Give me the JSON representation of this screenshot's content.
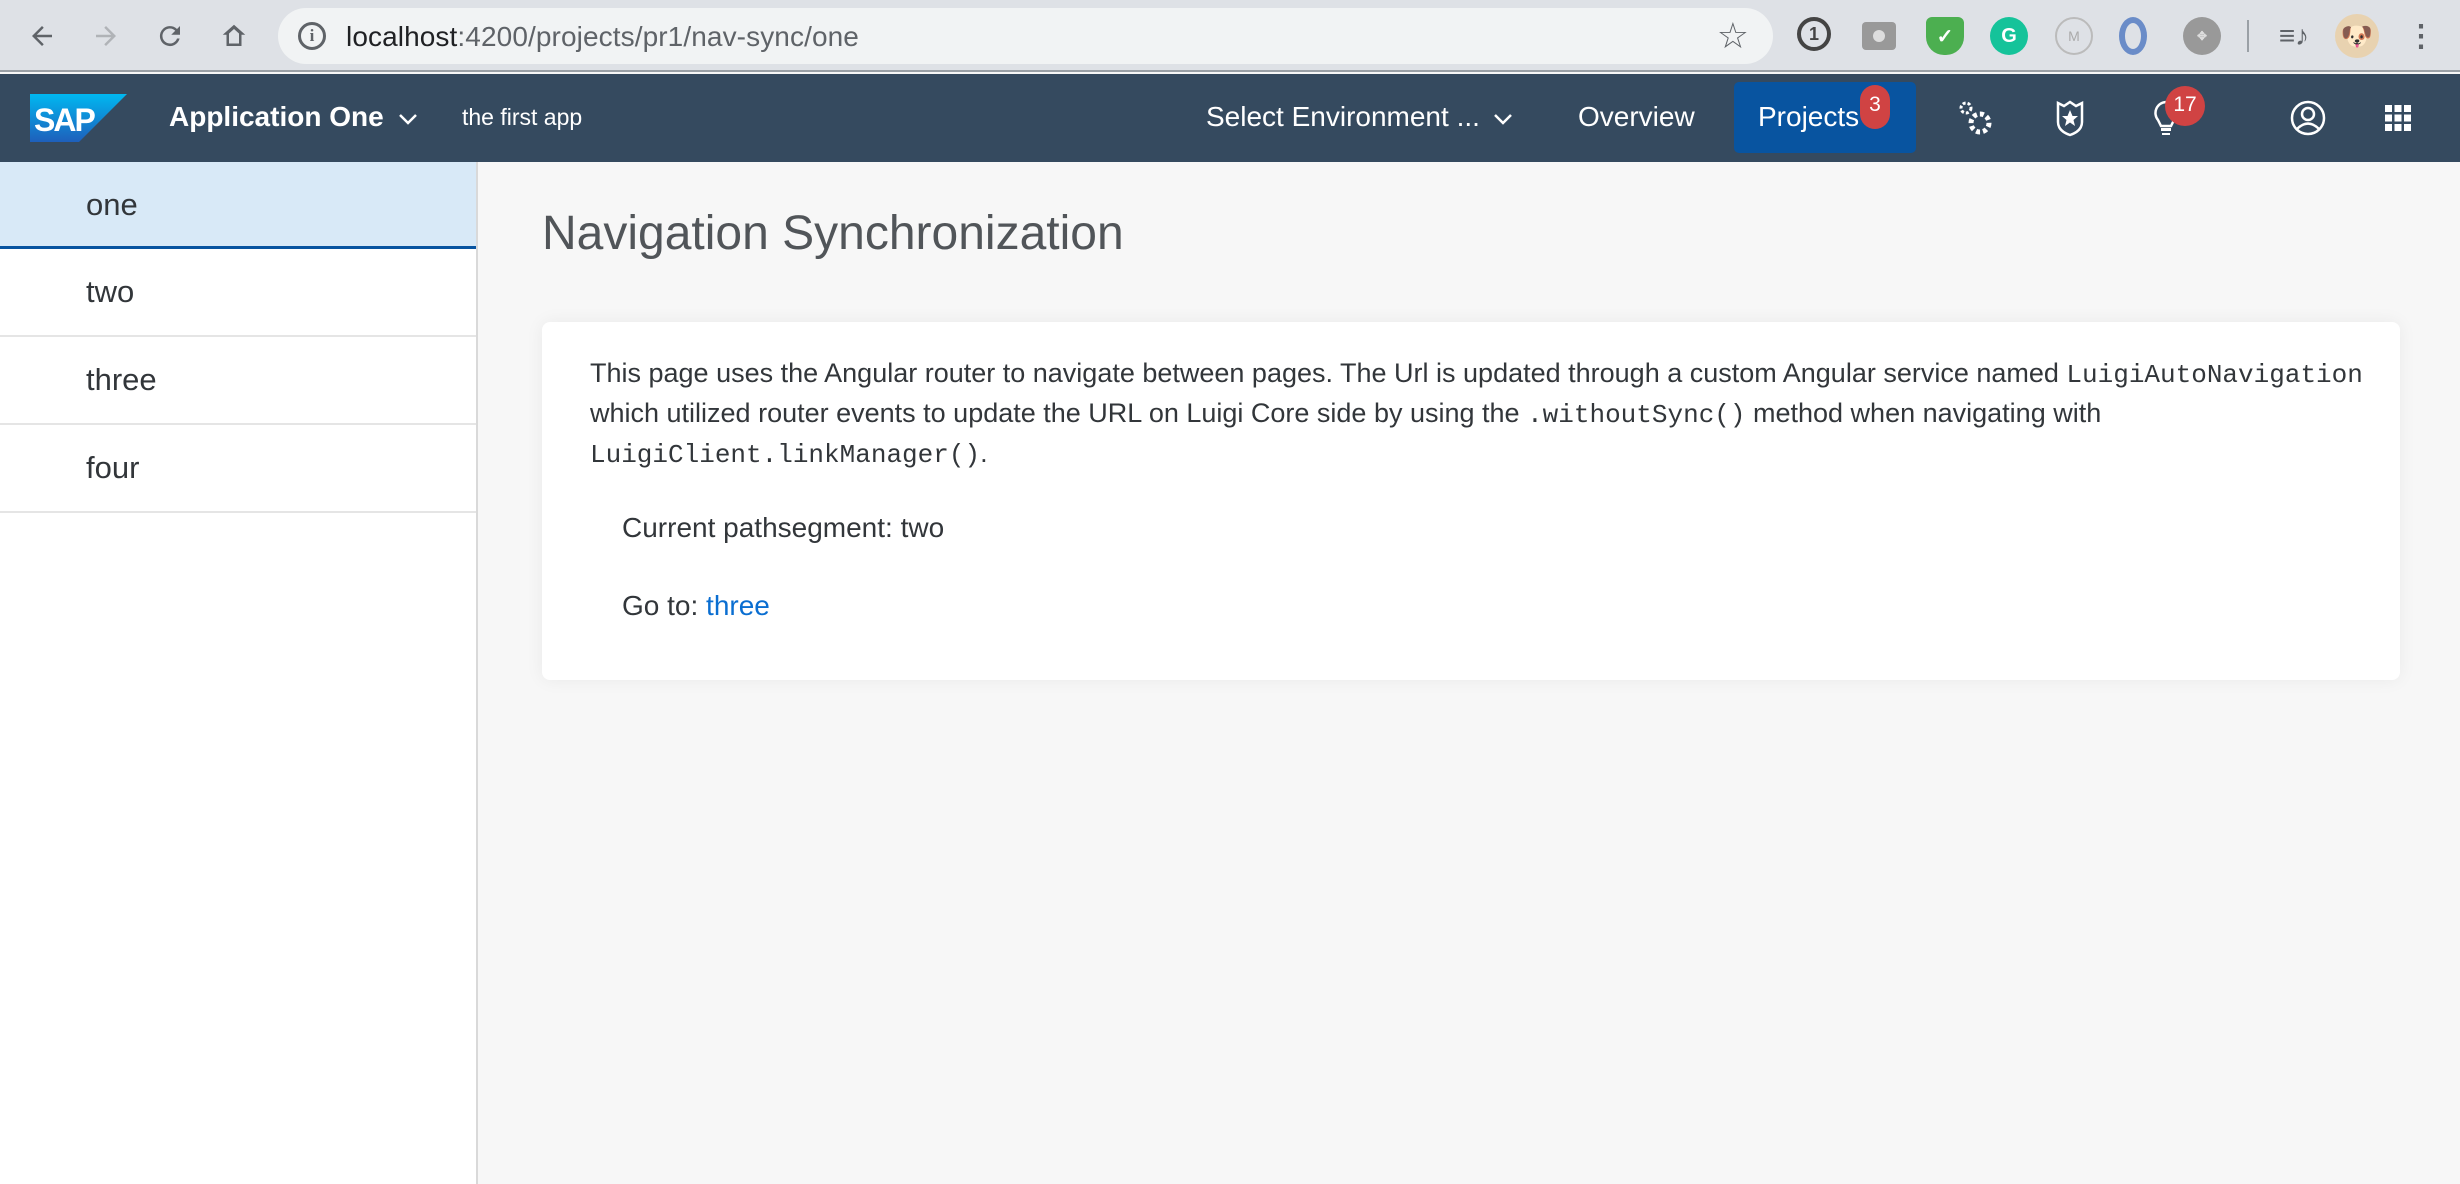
{
  "browser": {
    "url_host": "localhost",
    "url_path": ":4200/projects/pr1/nav-sync/one",
    "nav_icons": [
      "back-arrow-icon",
      "forward-arrow-icon",
      "reload-icon",
      "home-icon"
    ],
    "extensions": [
      "1password-icon",
      "camera-icon",
      "adguard-shield-icon",
      "grammarly-icon",
      "m-extension-icon",
      "ring-extension-icon",
      "dpad-extension-icon"
    ]
  },
  "shellbar": {
    "logo": "SAP",
    "app_title": "Application One",
    "app_subtitle": "the first app",
    "environment_select": "Select Environment ...",
    "nav": {
      "overview": "Overview",
      "projects": "Projects",
      "projects_badge": "3"
    },
    "notifications_badge": "17",
    "colors": {
      "shell_bg": "#354a5f",
      "active_nav_bg": "#0854a0",
      "badge_bg": "#d04343"
    }
  },
  "leftnav": {
    "items": [
      {
        "label": "one",
        "selected": true
      },
      {
        "label": "two",
        "selected": false
      },
      {
        "label": "three",
        "selected": false
      },
      {
        "label": "four",
        "selected": false
      }
    ]
  },
  "main": {
    "title": "Navigation Synchronization",
    "description": {
      "part1": "This page uses the Angular router to navigate between pages. The Url is updated through a custom Angular service named ",
      "code1": "LuigiAutoNavigation",
      "part2": " which utilized router events to update the URL on Luigi Core side by using the ",
      "code2": ".withoutSync()",
      "part3": " method when navigating with ",
      "code3": "LuigiClient.linkManager()",
      "part4": "."
    },
    "current_pathsegment_label": "Current pathsegment: two",
    "goto_label": "Go to: ",
    "goto_link": "three",
    "link_color": "#0a6ed1"
  }
}
